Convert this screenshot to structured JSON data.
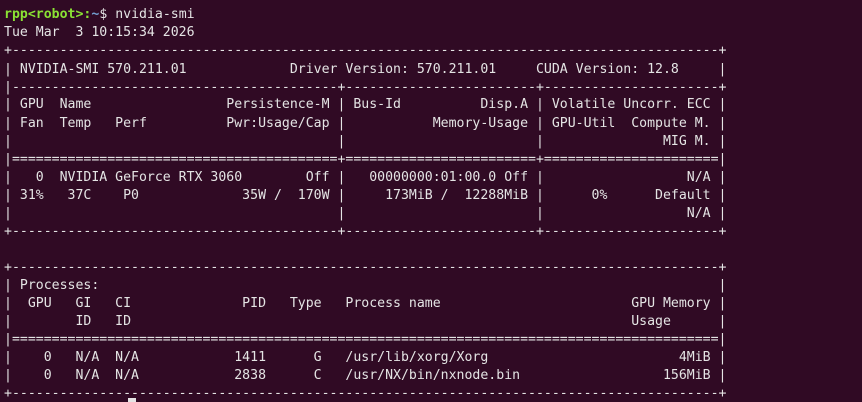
{
  "prompt": {
    "user_host": "rpp<robot>",
    "separator": ":",
    "path": "~",
    "symbol": "$ ",
    "command": "nvidia-smi"
  },
  "timestamp": "Tue Mar  3 10:15:34 2026",
  "gpu_table": {
    "top_border": "+-----------------------------------------------------------------------------------------+",
    "version_row": "| NVIDIA-SMI 570.211.01             Driver Version: 570.211.01     CUDA Version: 12.8     |",
    "divider": "|-----------------------------------------+------------------------+----------------------+",
    "header_rows": [
      "| GPU  Name                 Persistence-M | Bus-Id          Disp.A | Volatile Uncorr. ECC |",
      "| Fan  Temp   Perf          Pwr:Usage/Cap |           Memory-Usage | GPU-Util  Compute M. |",
      "|                                         |                        |               MIG M. |"
    ],
    "double_divider": "|=========================================+========================+======================|",
    "gpu_rows": [
      "|   0  NVIDIA GeForce RTX 3060        Off |   00000000:01:00.0 Off |                  N/A |",
      "| 31%   37C    P0             35W /  170W |     173MiB /  12288MiB |      0%      Default |",
      "|                                         |                        |                  N/A |"
    ],
    "bottom_border": "+-----------------------------------------+------------------------+----------------------+"
  },
  "process_table": {
    "top_border": "+-----------------------------------------------------------------------------------------+",
    "title_row": "| Processes:                                                                              |",
    "header_rows": [
      "|  GPU   GI   CI              PID   Type   Process name                        GPU Memory |",
      "|        ID   ID                                                               Usage      |"
    ],
    "double_divider": "|=========================================================================================|",
    "process_rows": [
      "|    0   N/A  N/A            1411      G   /usr/lib/xorg/Xorg                        4MiB |",
      "|    0   N/A  N/A            2838      C   /usr/NX/bin/nxnode.bin                  156MiB |"
    ],
    "bottom_border": "+-----------------------------------------------------------------------------------------+"
  }
}
